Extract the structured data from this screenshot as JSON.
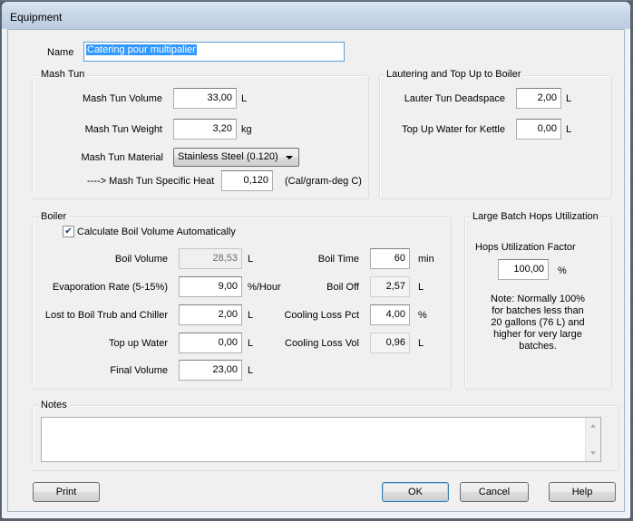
{
  "window": {
    "title": "Equipment"
  },
  "name": {
    "label": "Name",
    "value": "Catering pour multipalier"
  },
  "mash_tun": {
    "title": "Mash Tun",
    "volume_label": "Mash Tun Volume",
    "volume_value": "33,00",
    "volume_unit": "L",
    "weight_label": "Mash Tun Weight",
    "weight_value": "3,20",
    "weight_unit": "kg",
    "material_label": "Mash Tun Material",
    "material_value": "Stainless Steel (0.120)",
    "specific_heat_label": "----> Mash Tun Specific Heat",
    "specific_heat_value": "0,120",
    "specific_heat_unit": "(Cal/gram-deg C)"
  },
  "lautering": {
    "title": "Lautering and Top Up to Boiler",
    "deadspace_label": "Lauter Tun Deadspace",
    "deadspace_value": "2,00",
    "deadspace_unit": "L",
    "topup_kettle_label": "Top Up Water for Kettle",
    "topup_kettle_value": "0,00",
    "topup_kettle_unit": "L"
  },
  "boiler": {
    "title": "Boiler",
    "calc_auto_label": "Calculate Boil Volume Automatically",
    "calc_auto_checked": true,
    "boil_volume_label": "Boil Volume",
    "boil_volume_value": "28,53",
    "boil_volume_unit": "L",
    "evaporation_label": "Evaporation Rate (5-15%)",
    "evaporation_value": "9,00",
    "evaporation_unit": "%/Hour",
    "trub_label": "Lost to Boil Trub and Chiller",
    "trub_value": "2,00",
    "trub_unit": "L",
    "topup_label": "Top up Water",
    "topup_value": "0,00",
    "topup_unit": "L",
    "final_label": "Final Volume",
    "final_value": "23,00",
    "final_unit": "L",
    "boil_time_label": "Boil Time",
    "boil_time_value": "60",
    "boil_time_unit": "min",
    "boil_off_label": "Boil Off",
    "boil_off_value": "2,57",
    "boil_off_unit": "L",
    "cooling_pct_label": "Cooling Loss Pct",
    "cooling_pct_value": "4,00",
    "cooling_pct_unit": "%",
    "cooling_vol_label": "Cooling Loss Vol",
    "cooling_vol_value": "0,96",
    "cooling_vol_unit": "L"
  },
  "hops": {
    "title": "Large Batch Hops Utilization",
    "factor_label": "Hops Utilization Factor",
    "factor_value": "100,00",
    "factor_unit": "%",
    "note_lines": [
      "Note: Normally 100%",
      "for batches less than",
      "20 gallons (76 L) and",
      "higher for very large",
      "batches."
    ]
  },
  "notes": {
    "title": "Notes",
    "value": ""
  },
  "buttons": {
    "print": "Print",
    "ok": "OK",
    "cancel": "Cancel",
    "help": "Help"
  }
}
